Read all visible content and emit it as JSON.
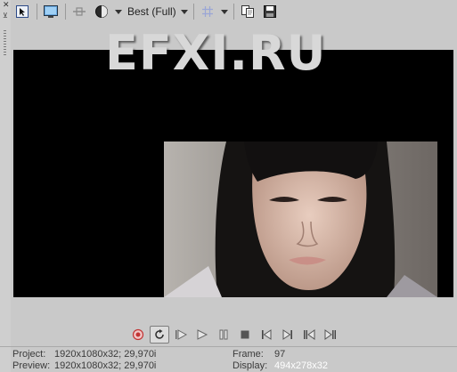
{
  "watermark": "EFXI.RU",
  "toolbar": {
    "quality": "Best (Full)",
    "icons": [
      "select-icon",
      "monitor-icon",
      "split-icon",
      "overlay-circle-icon",
      "grid-icon",
      "copy-icon",
      "save-icon"
    ]
  },
  "status": {
    "project_label": "Project:",
    "project_value": "1920x1080x32; 29,970i",
    "preview_label": "Preview:",
    "preview_value": "1920x1080x32; 29,970i",
    "frame_label": "Frame:",
    "frame_value": "97",
    "display_label": "Display:",
    "display_value": "494x278x32"
  }
}
